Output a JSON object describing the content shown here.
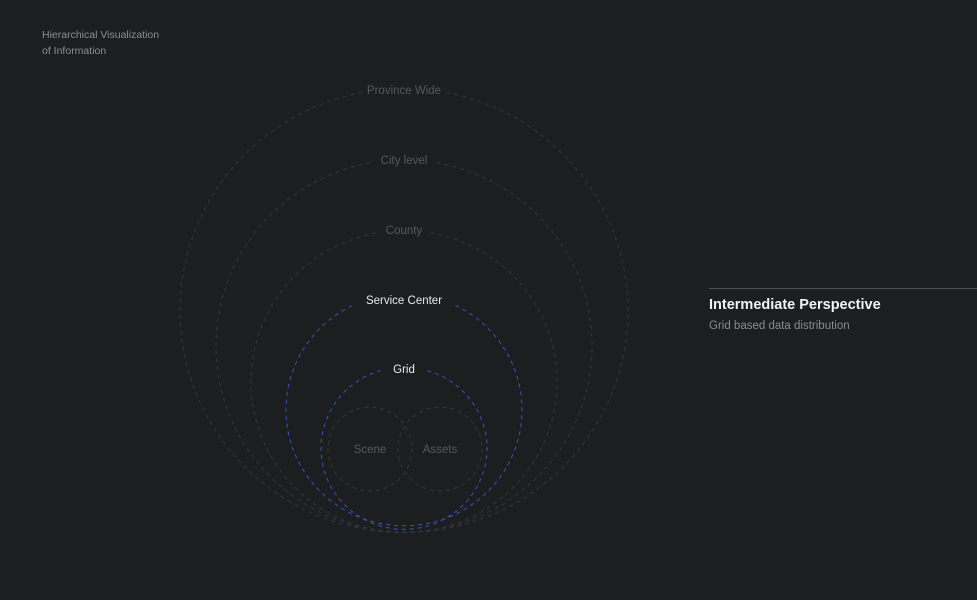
{
  "header": {
    "title_line1": "Hierarchical Visualization",
    "title_line2": "of Information"
  },
  "hierarchy": {
    "levels": [
      {
        "label": "Province Wide",
        "state": "inactive"
      },
      {
        "label": "City level",
        "state": "inactive"
      },
      {
        "label": "County",
        "state": "inactive"
      },
      {
        "label": "Service Center",
        "state": "active"
      },
      {
        "label": "Grid",
        "state": "active"
      }
    ],
    "leaves": [
      {
        "label": "Scene",
        "state": "inactive"
      },
      {
        "label": "Assets",
        "state": "inactive"
      }
    ]
  },
  "detail": {
    "title": "Intermediate Perspective",
    "subtitle": "Grid based data distribution"
  },
  "colors": {
    "background": "#1d1e20",
    "ring_inactive": "#34363c",
    "ring_active": "#3d4fc2",
    "text_active": "#e9eaec",
    "text_inactive": "#55585e"
  }
}
